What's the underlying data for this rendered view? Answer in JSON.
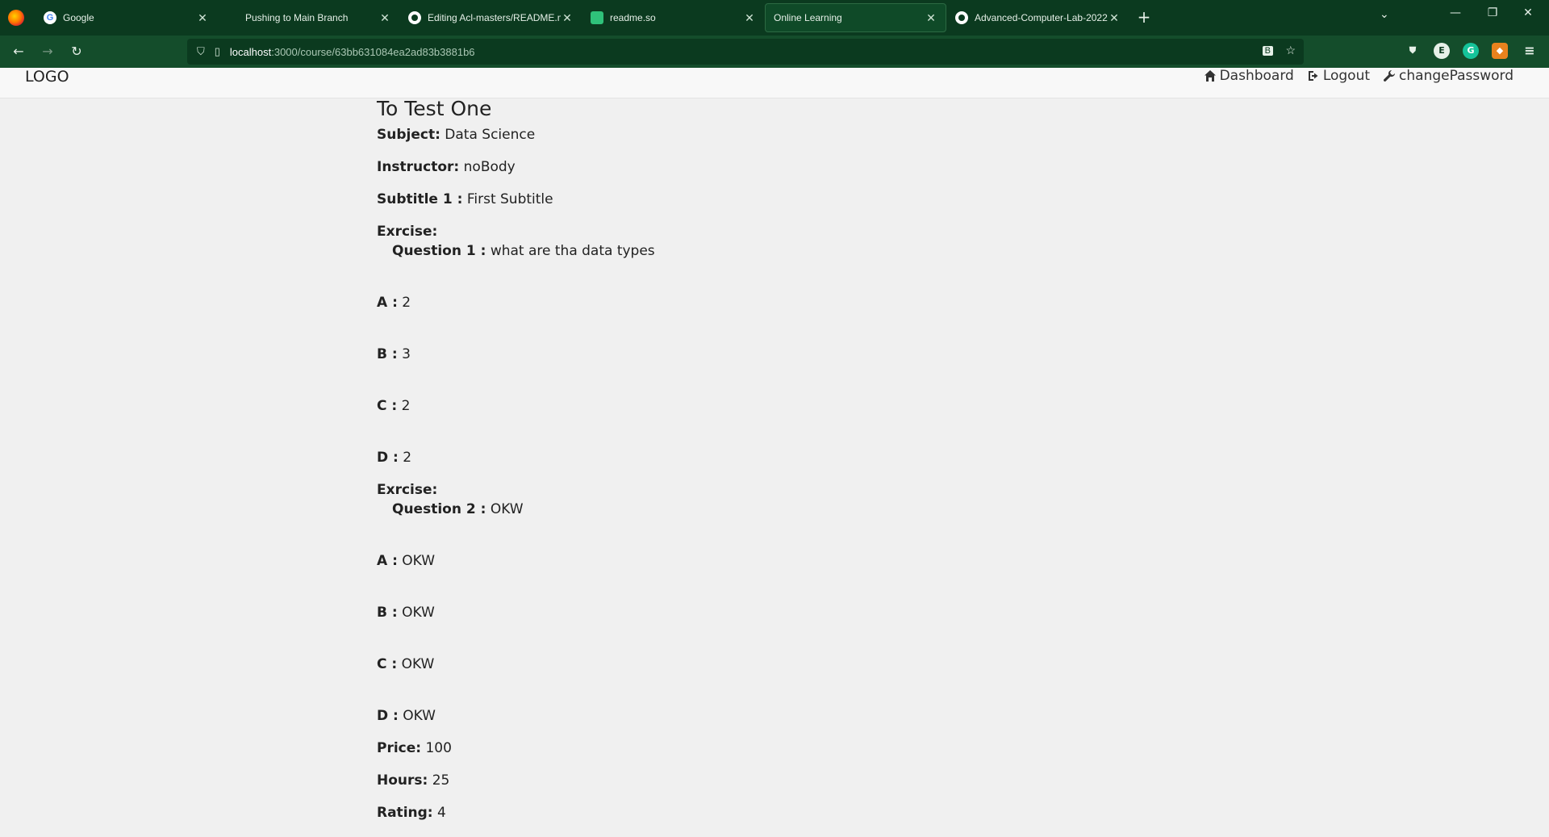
{
  "browser": {
    "tabs": [
      {
        "title": "Google",
        "icon": "google-icon",
        "active": false
      },
      {
        "title": "Pushing to Main Branch",
        "icon": "",
        "active": false
      },
      {
        "title": "Editing Acl-masters/README.md",
        "icon": "github-icon",
        "active": false
      },
      {
        "title": "readme.so",
        "icon": "readme-icon",
        "active": false
      },
      {
        "title": "Online Learning",
        "icon": "",
        "active": true
      },
      {
        "title": "Advanced-Computer-Lab-2022",
        "icon": "github-icon",
        "active": false
      }
    ],
    "url": {
      "host": "localhost",
      "path": ":3000/course/63bb631084ea2ad83b3881b6"
    },
    "colors": {
      "chrome_bg": "#0b3a1f",
      "toolbar_bg": "#144d2b"
    }
  },
  "header": {
    "logo": "LOGO",
    "links": {
      "dashboard": "Dashboard",
      "logout": "Logout",
      "change_password": "changePassword"
    }
  },
  "course": {
    "title": "To Test One",
    "subject_label": "Subject:",
    "subject": "Data Science",
    "instructor_label": "Instructor:",
    "instructor": "noBody",
    "subtitle_label": "Subtitle 1 :",
    "subtitle": "First Subtitle",
    "exercises": [
      {
        "heading": "Exrcise:",
        "question_label": "Question 1 :",
        "question": "what are tha data types",
        "choices": [
          {
            "label": "A :",
            "value": "2"
          },
          {
            "label": "B :",
            "value": "3"
          },
          {
            "label": "C :",
            "value": "2"
          },
          {
            "label": "D :",
            "value": "2"
          }
        ]
      },
      {
        "heading": "Exrcise:",
        "question_label": "Question 2 :",
        "question": "OKW",
        "choices": [
          {
            "label": "A :",
            "value": "OKW"
          },
          {
            "label": "B :",
            "value": "OKW"
          },
          {
            "label": "C :",
            "value": "OKW"
          },
          {
            "label": "D :",
            "value": "OKW"
          }
        ]
      }
    ],
    "price_label": "Price:",
    "price": "100",
    "hours_label": "Hours:",
    "hours": "25",
    "rating_label": "Rating:",
    "rating": "4"
  }
}
